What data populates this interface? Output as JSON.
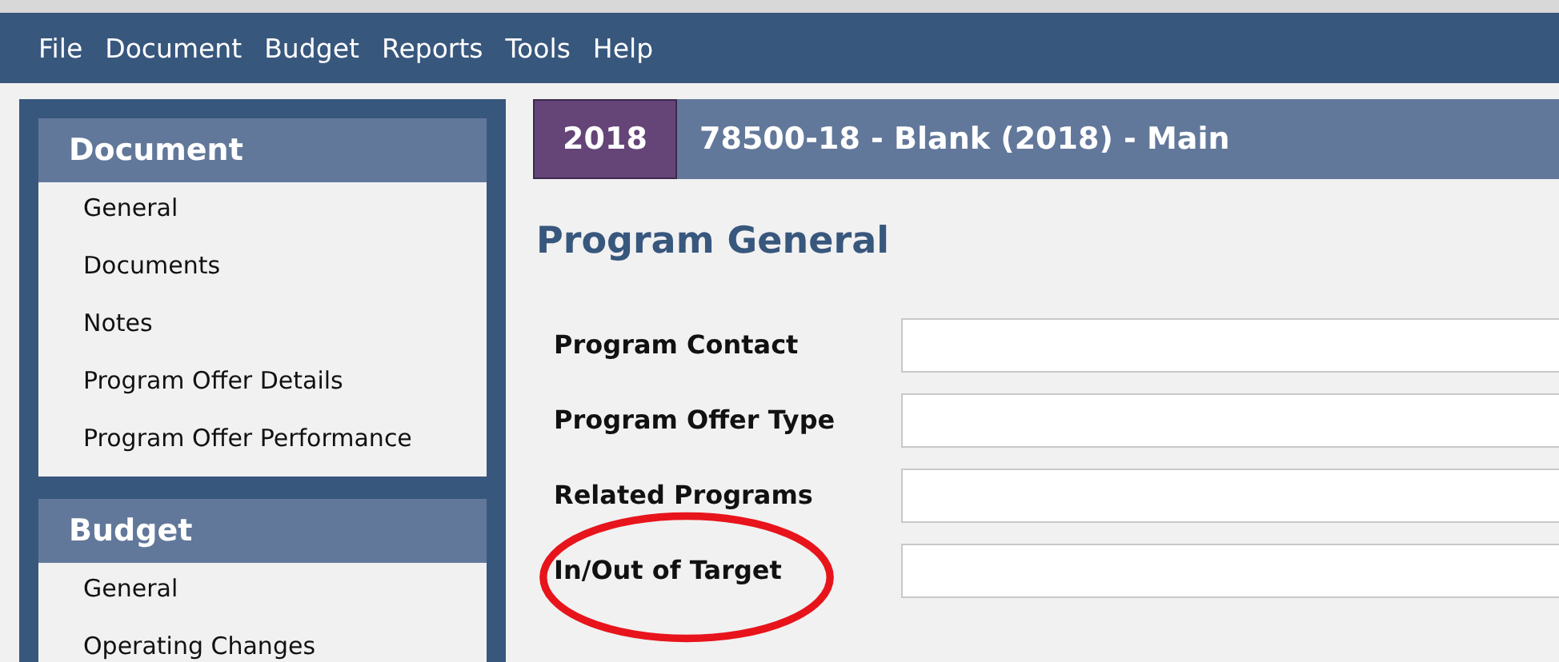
{
  "menu": [
    "File",
    "Document",
    "Budget",
    "Reports",
    "Tools",
    "Help"
  ],
  "sidebar": {
    "sections": [
      {
        "title": "Document",
        "items": [
          "General",
          "Documents",
          "Notes",
          "Program Offer Details",
          "Program Offer Performance"
        ]
      },
      {
        "title": "Budget",
        "items": [
          "General",
          "Operating Changes"
        ]
      }
    ]
  },
  "header": {
    "year": "2018",
    "title": "78500-18 - Blank (2018) - Main"
  },
  "page_title": "Program General",
  "fields": [
    {
      "label": "Program Contact",
      "highlighted": false
    },
    {
      "label": "Program Offer Type",
      "highlighted": false
    },
    {
      "label": "Related Programs",
      "highlighted": false
    },
    {
      "label": "In/Out of Target",
      "highlighted": true
    }
  ]
}
